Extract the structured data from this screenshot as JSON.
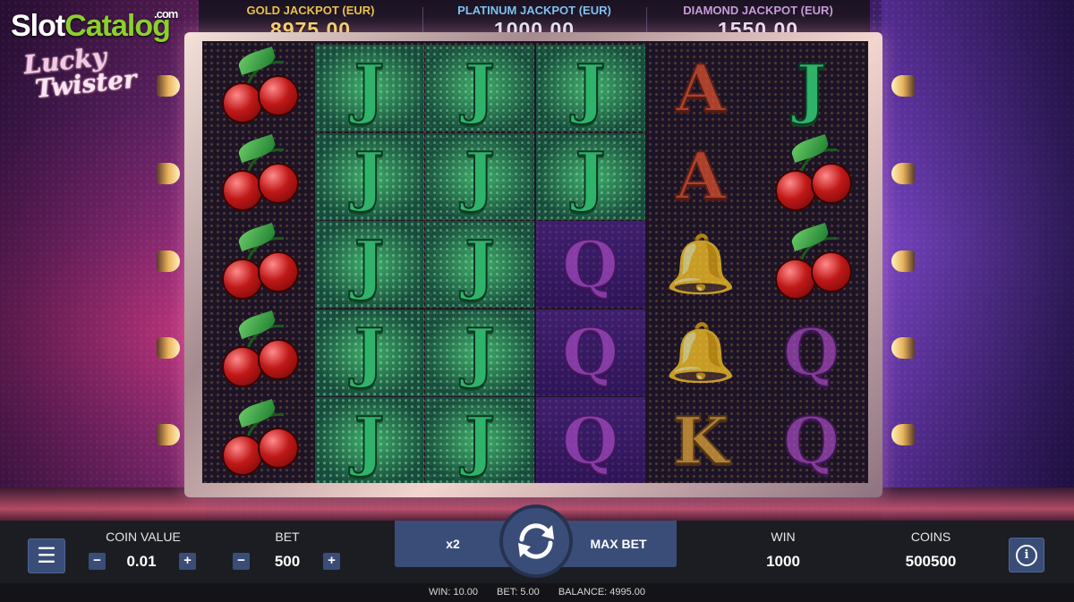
{
  "site_logo": {
    "part1": "Slot",
    "part2": "Catalog",
    "suffix": ".com"
  },
  "game_logo": {
    "line1": "Lucky",
    "line2": "Twister"
  },
  "jackpots": [
    {
      "label": "GOLD JACKPOT (EUR)",
      "value": "8975.00"
    },
    {
      "label": "PLATINUM JACKPOT (EUR)",
      "value": "1000.00"
    },
    {
      "label": "DIAMOND JACKPOT (EUR)",
      "value": "1550.00"
    }
  ],
  "reels": {
    "grid": [
      [
        "cherry",
        "J",
        "J",
        "J",
        "A",
        "J"
      ],
      [
        "cherry",
        "J",
        "J",
        "J",
        "A",
        "cherry"
      ],
      [
        "cherry",
        "J",
        "J",
        "Q",
        "bell",
        "cherry"
      ],
      [
        "cherry",
        "J",
        "J",
        "Q",
        "bell",
        "Q"
      ],
      [
        "cherry",
        "J",
        "J",
        "Q",
        "K",
        "Q"
      ]
    ],
    "winning_cells": [
      [
        0,
        1
      ],
      [
        0,
        2
      ],
      [
        0,
        3
      ],
      [
        1,
        1
      ],
      [
        1,
        2
      ],
      [
        1,
        3
      ],
      [
        2,
        1
      ],
      [
        2,
        2
      ],
      [
        3,
        1
      ],
      [
        3,
        2
      ],
      [
        4,
        1
      ],
      [
        4,
        2
      ]
    ]
  },
  "controls": {
    "menu_icon": "hamburger-menu-icon",
    "coin_value_label": "COIN VALUE",
    "coin_value": "0.01",
    "bet_label": "BET",
    "bet_value": "500",
    "minus": "−",
    "plus": "+",
    "x2_label": "x2",
    "max_bet_label": "MAX BET",
    "spin_icon": "spin-arrows-icon",
    "win_label": "WIN",
    "win_value": "1000",
    "coins_label": "COINS",
    "coins_value": "500500",
    "info_icon": "info-icon",
    "info_glyph": "i"
  },
  "status": {
    "win": "WIN: 10.00",
    "bet": "BET: 5.00",
    "balance": "BALANCE: 4995.00"
  },
  "colors": {
    "panel": "#3a4d78",
    "bar": "#1c1d22",
    "win_cell": "#46c878",
    "gold": "#f4d36a"
  }
}
